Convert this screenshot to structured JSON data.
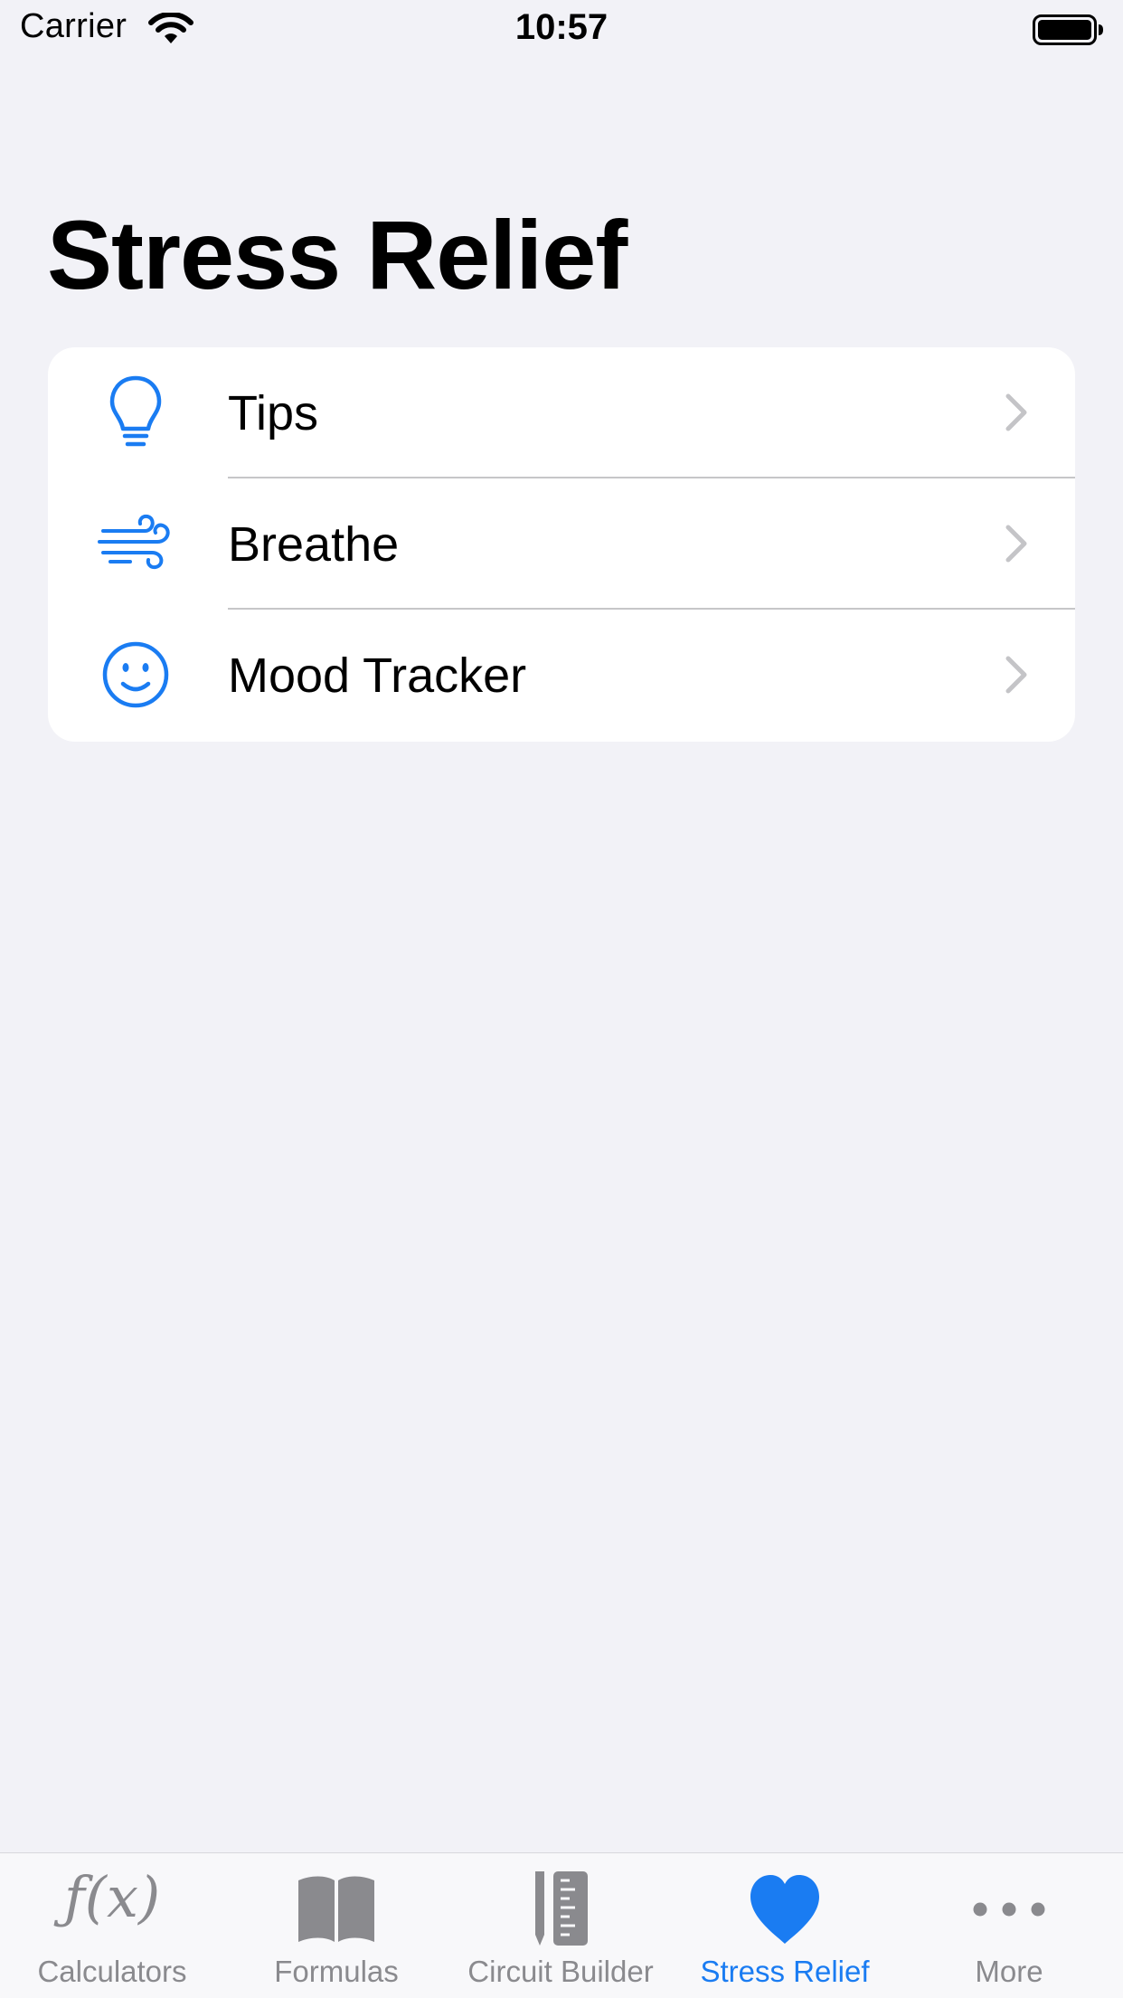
{
  "status_bar": {
    "carrier": "Carrier",
    "time": "10:57",
    "wifi_icon": "wifi-icon",
    "battery_icon": "battery-full-icon"
  },
  "page": {
    "title": "Stress Relief"
  },
  "menu": {
    "items": [
      {
        "label": "Tips",
        "icon": "lightbulb-icon"
      },
      {
        "label": "Breathe",
        "icon": "wind-icon"
      },
      {
        "label": "Mood Tracker",
        "icon": "smiley-face-icon"
      }
    ]
  },
  "tab_bar": {
    "tabs": [
      {
        "label": "Calculators",
        "icon": "function-icon",
        "glyph": "ƒ(x)",
        "active": false
      },
      {
        "label": "Formulas",
        "icon": "book-icon",
        "active": false
      },
      {
        "label": "Circuit Builder",
        "icon": "pencil-ruler-icon",
        "active": false
      },
      {
        "label": "Stress Relief",
        "icon": "heart-icon",
        "active": true
      },
      {
        "label": "More",
        "icon": "ellipsis-icon",
        "active": false
      }
    ]
  },
  "colors": {
    "accent": "#1a7cf2",
    "inactive": "#8a8a8e",
    "background": "#f2f2f7",
    "card": "#ffffff",
    "separator": "#c6c6c8",
    "chevron": "#c4c4c7"
  }
}
